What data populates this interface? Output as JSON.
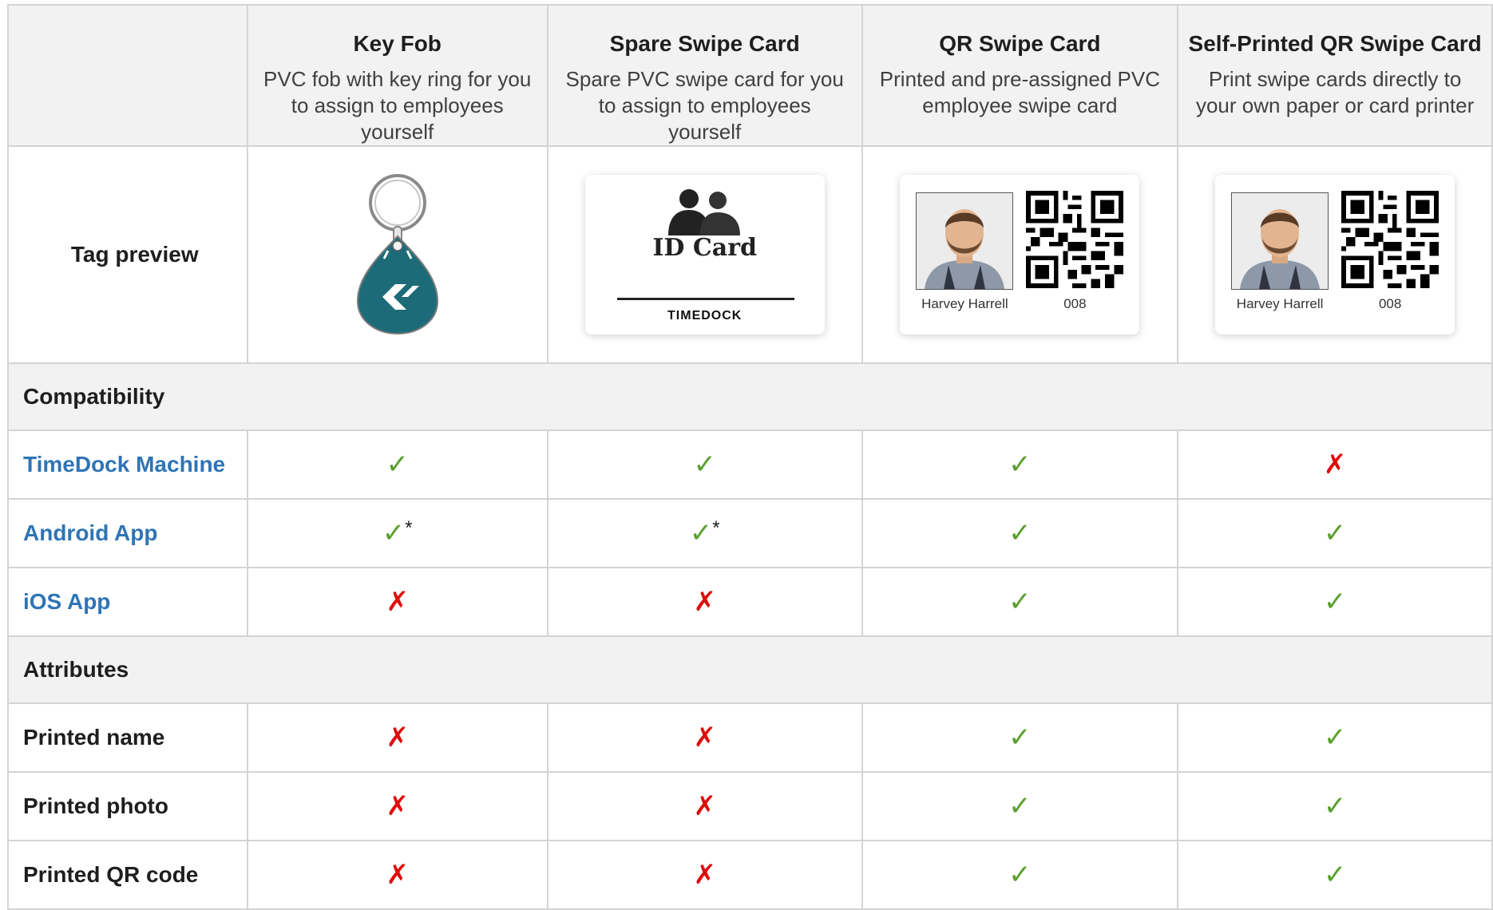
{
  "columns": [
    {
      "title": "Key Fob",
      "desc": "PVC fob with key ring for you to assign to employees yourself"
    },
    {
      "title": "Spare Swipe Card",
      "desc": "Spare PVC swipe card for you to assign to employees yourself"
    },
    {
      "title": "QR Swipe Card",
      "desc": "Printed and pre-assigned PVC employee swipe card"
    },
    {
      "title": "Self-Printed QR Swipe Card",
      "desc": "Print swipe cards directly to your own paper or card printer"
    }
  ],
  "preview": {
    "label": "Tag preview",
    "id_card_title": "ID Card",
    "id_card_brand": "TIMEDOCK",
    "card_name": "Harvey Harrell",
    "card_number": "008"
  },
  "sections": {
    "compatibility": "Compatibility",
    "attributes": "Attributes"
  },
  "symbols": {
    "yes": "✓",
    "no": "✗",
    "note": "*"
  },
  "compatibility_rows": [
    {
      "label": "TimeDock Machine",
      "values": [
        "yes",
        "yes",
        "yes",
        "no"
      ],
      "notes": [
        false,
        false,
        false,
        false
      ]
    },
    {
      "label": "Android App",
      "values": [
        "yes",
        "yes",
        "yes",
        "yes"
      ],
      "notes": [
        true,
        true,
        false,
        false
      ]
    },
    {
      "label": "iOS App",
      "values": [
        "no",
        "no",
        "yes",
        "yes"
      ],
      "notes": [
        false,
        false,
        false,
        false
      ]
    }
  ],
  "attribute_rows": [
    {
      "label": "Printed name",
      "values": [
        "no",
        "no",
        "yes",
        "yes"
      ]
    },
    {
      "label": "Printed photo",
      "values": [
        "no",
        "no",
        "yes",
        "yes"
      ]
    },
    {
      "label": "Printed QR code",
      "values": [
        "no",
        "no",
        "yes",
        "yes"
      ]
    }
  ],
  "colors": {
    "link": "#2f74b5",
    "yes": "#5aa02c",
    "no": "#e00b0b",
    "fob": "#1d6b78"
  }
}
